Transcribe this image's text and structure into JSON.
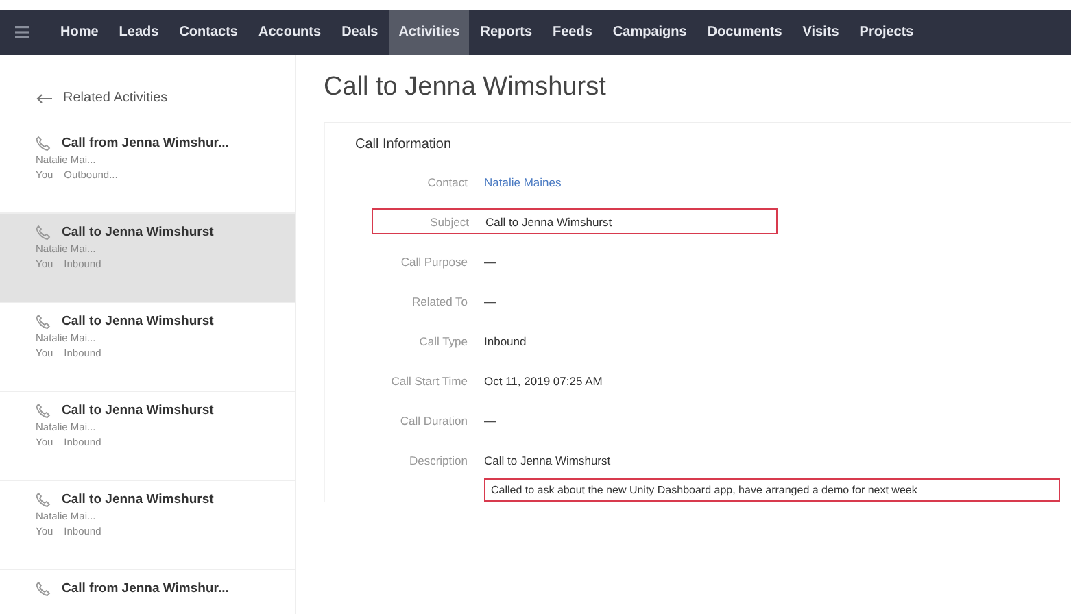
{
  "nav": {
    "items": [
      {
        "label": "Home",
        "selected": false
      },
      {
        "label": "Leads",
        "selected": false
      },
      {
        "label": "Contacts",
        "selected": false
      },
      {
        "label": "Accounts",
        "selected": false
      },
      {
        "label": "Deals",
        "selected": false
      },
      {
        "label": "Activities",
        "selected": true
      },
      {
        "label": "Reports",
        "selected": false
      },
      {
        "label": "Feeds",
        "selected": false
      },
      {
        "label": "Campaigns",
        "selected": false
      },
      {
        "label": "Documents",
        "selected": false
      },
      {
        "label": "Visits",
        "selected": false
      },
      {
        "label": "Projects",
        "selected": false
      }
    ]
  },
  "sidebar": {
    "title": "Related Activities",
    "items": [
      {
        "title": "Call from Jenna Wimshur...",
        "contact": "Natalie Mai...",
        "owner": "You",
        "type": "Outbound...",
        "selected": false
      },
      {
        "title": "Call to Jenna Wimshurst",
        "contact": "Natalie Mai...",
        "owner": "You",
        "type": "Inbound",
        "selected": true
      },
      {
        "title": "Call to Jenna Wimshurst",
        "contact": "Natalie Mai...",
        "owner": "You",
        "type": "Inbound",
        "selected": false
      },
      {
        "title": "Call to Jenna Wimshurst",
        "contact": "Natalie Mai...",
        "owner": "You",
        "type": "Inbound",
        "selected": false
      },
      {
        "title": "Call to Jenna Wimshurst",
        "contact": "Natalie Mai...",
        "owner": "You",
        "type": "Inbound",
        "selected": false
      },
      {
        "title": "Call from Jenna Wimshur..."
      }
    ]
  },
  "record": {
    "title": "Call to Jenna Wimshurst",
    "section": "Call Information",
    "fields": [
      {
        "label": "Contact",
        "value": "Natalie Maines",
        "kind": "link",
        "highlighted": false
      },
      {
        "label": "Subject",
        "value": "Call to Jenna Wimshurst",
        "kind": "text",
        "highlighted": true
      },
      {
        "label": "Call Purpose",
        "value": "—",
        "kind": "text",
        "highlighted": false
      },
      {
        "label": "Related To",
        "value": "—",
        "kind": "text",
        "highlighted": false
      },
      {
        "label": "Call Type",
        "value": "Inbound",
        "kind": "text",
        "highlighted": false
      },
      {
        "label": "Call Start Time",
        "value": "Oct 11, 2019 07:25 AM",
        "kind": "text",
        "highlighted": false
      },
      {
        "label": "Call Duration",
        "value": "—",
        "kind": "text",
        "highlighted": false
      },
      {
        "label": "Description",
        "value": "Call to Jenna Wimshurst",
        "kind": "text",
        "highlighted": false
      },
      {
        "value": "Called to ask about the new Unity Dashboard app, have arranged a demo for next week",
        "kind": "note",
        "highlighted": true
      }
    ]
  }
}
